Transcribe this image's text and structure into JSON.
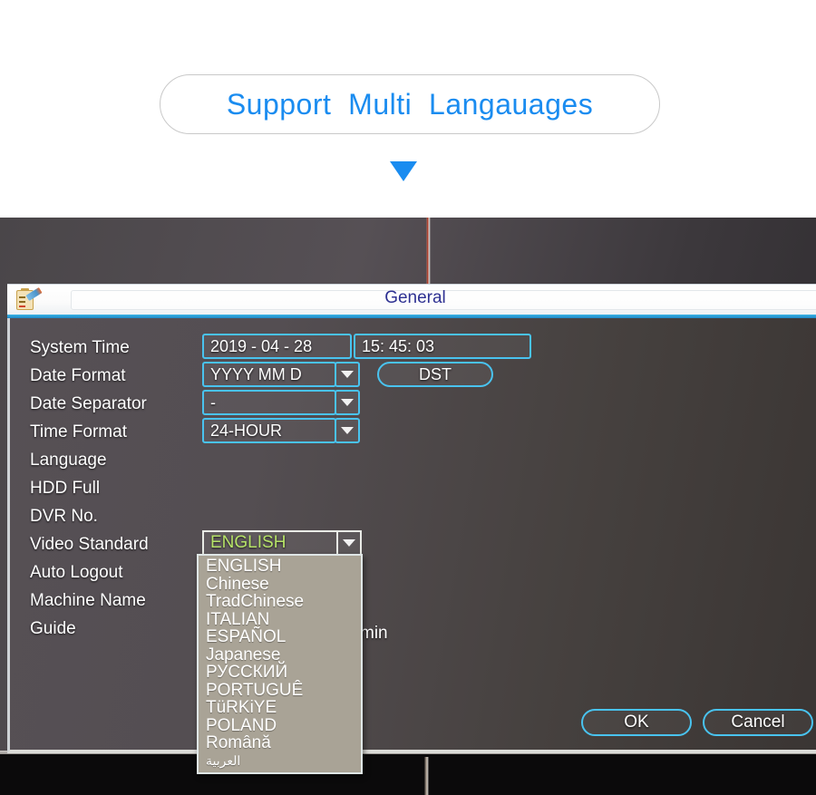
{
  "promo": {
    "headline": "Support  Multi  Langauages",
    "arrow_icon": "triangle-down-icon",
    "accent_color": "#1a8cf0"
  },
  "dialog": {
    "title": "General",
    "title_icon": "clipboard-pencil-icon",
    "accent_color": "#49c3ef",
    "rows": [
      {
        "label": "System Time"
      },
      {
        "label": "Date Format"
      },
      {
        "label": "Date Separator"
      },
      {
        "label": "Time Format"
      },
      {
        "label": "Language"
      },
      {
        "label": "HDD Full"
      },
      {
        "label": "DVR No."
      },
      {
        "label": "Video Standard"
      },
      {
        "label": "Auto Logout"
      },
      {
        "label": "Machine Name"
      },
      {
        "label": "Guide"
      }
    ],
    "fields": {
      "system_date": "2019 - 04 - 28",
      "system_time": "15: 45: 03",
      "date_format": "YYYY MM D",
      "dst_label": "DST",
      "date_separator": "-",
      "time_format": "24-HOUR",
      "language": "ENGLISH",
      "language_color": "#b6e368",
      "auto_logout_suffix": "min",
      "dropdown_arrow_icon": "chevron-down-icon"
    },
    "language_options": [
      "ENGLISH",
      "Chinese",
      "TradChinese",
      "ITALIAN",
      "ESPAÑOL",
      "Japanese",
      "РУССКИЙ",
      "PORTUGUÊ",
      "TüRKiYE",
      "POLAND",
      "Română",
      "العربية"
    ],
    "footer": {
      "ok_label": "OK",
      "cancel_label": "Cancel"
    }
  }
}
